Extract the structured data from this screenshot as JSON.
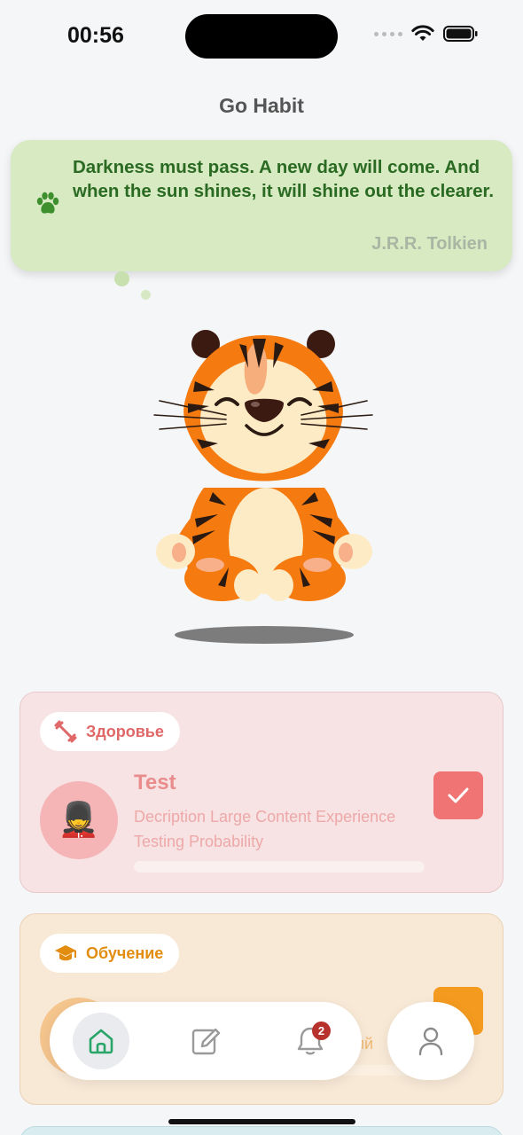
{
  "status": {
    "time": "00:56"
  },
  "app": {
    "title": "Go Habit"
  },
  "quote": {
    "text": "Darkness must pass. A new day will come. And when the sun shines, it will shine out the clearer.",
    "author": "J.R.R. Tolkien"
  },
  "cards": {
    "health": {
      "category": "Здоровье",
      "habit_title": "Test",
      "habit_description": "Decription Large Content Experience Testing Probability",
      "avatar_emoji": "💂",
      "color": "#f07474"
    },
    "education": {
      "category": "Обучение",
      "partial_text": "ий",
      "color": "#f49a1f"
    }
  },
  "nav": {
    "notifications_count": "2",
    "icons": [
      "home-icon",
      "edit-icon",
      "bell-icon",
      "profile-icon"
    ]
  }
}
